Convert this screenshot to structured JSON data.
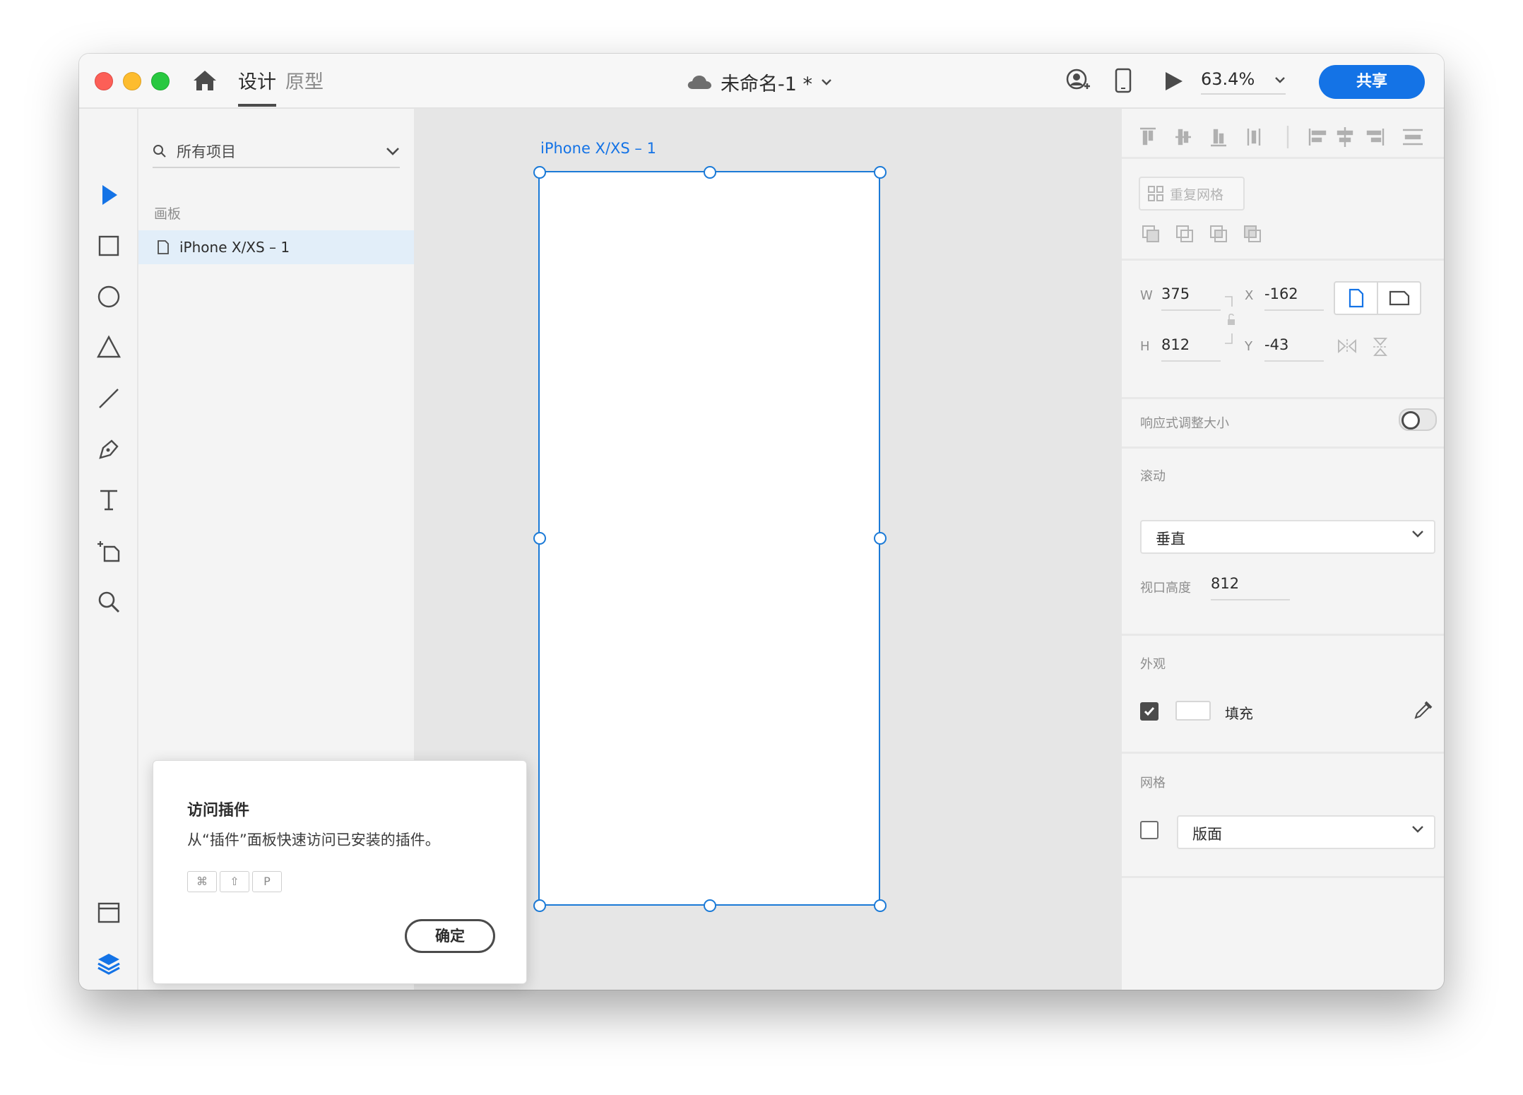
{
  "titlebar": {
    "tabs": [
      {
        "label": "设计"
      },
      {
        "label": "原型"
      }
    ],
    "document_title": "未命名-1 *",
    "zoom": "63.4%",
    "share_label": "共享"
  },
  "layers": {
    "search_placeholder": "所有项目",
    "section_label": "画板",
    "items": [
      {
        "label": "iPhone X/XS – 1"
      }
    ]
  },
  "canvas": {
    "artboard_label": "iPhone X/XS – 1"
  },
  "toast": {
    "title": "访问插件",
    "body": "从“插件”面板快速访问已安装的插件。",
    "keys": [
      "⌘",
      "⇧",
      "P"
    ],
    "ok_label": "确定"
  },
  "properties": {
    "repeat_grid_label": "重复网格",
    "w_label": "W",
    "w_value": "375",
    "h_label": "H",
    "h_value": "812",
    "x_label": "X",
    "x_value": "-162",
    "y_label": "Y",
    "y_value": "-43",
    "responsive_label": "响应式调整大小",
    "scroll_label": "滚动",
    "scroll_value": "垂直",
    "viewport_label": "视口高度",
    "viewport_value": "812",
    "appearance_label": "外观",
    "fill_label": "填充",
    "grid_label": "网格",
    "grid_value": "版面"
  },
  "colors": {
    "accent": "#1473e6",
    "selection": "#1b7ad7"
  }
}
